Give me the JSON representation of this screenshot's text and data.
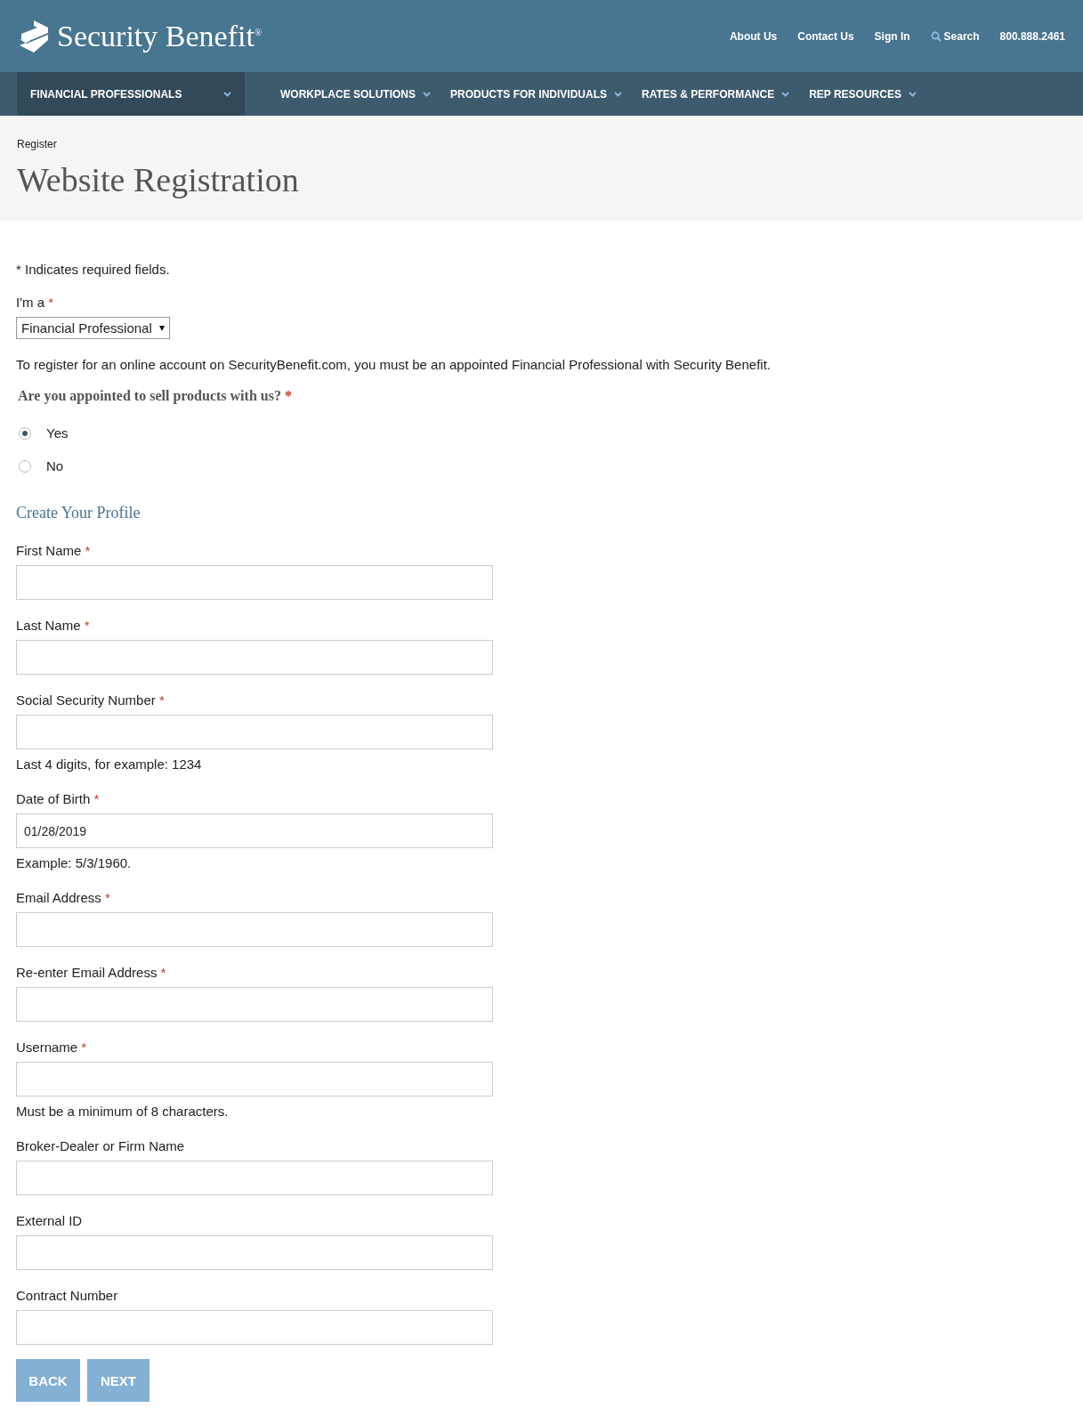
{
  "header": {
    "brand": "Security Benefit",
    "brand_mark": "®",
    "links": [
      "About Us",
      "Contact Us",
      "Sign In"
    ],
    "search": "Search",
    "phone": "800.888.2461"
  },
  "nav": {
    "audience": {
      "label": "FINANCIAL PROFESSIONALS",
      "selected": true
    },
    "items": [
      {
        "label": "WORKPLACE SOLUTIONS"
      },
      {
        "label": "PRODUCTS FOR INDIVIDUALS"
      },
      {
        "label": "RATES & PERFORMANCE"
      },
      {
        "label": "REP RESOURCES"
      }
    ]
  },
  "breadcrumb": "Register",
  "title": "Website Registration",
  "required_note": "* Indicates required fields.",
  "role": {
    "label": "I'm a",
    "required_mark": "*",
    "value": "Financial Professional"
  },
  "intro": "To register for an online account on SecurityBenefit.com, you must be an appointed Financial Professional with Security Benefit.",
  "question": {
    "label": "Are you appointed to sell products with us?",
    "required_mark": "*",
    "options": [
      {
        "label": "Yes",
        "selected": true
      },
      {
        "label": "No",
        "selected": false
      }
    ]
  },
  "section_title": "Create Your Profile",
  "fields": [
    {
      "label": "First Name",
      "required_mark": "*"
    },
    {
      "label": "Last Name",
      "required_mark": "*"
    },
    {
      "label": "Social Security Number",
      "required_mark": "*",
      "hint": "Last 4 digits, for example: 1234"
    },
    {
      "label": "Date of Birth",
      "required_mark": "*",
      "value": "01/28/2019",
      "hint": "Example: 5/3/1960."
    },
    {
      "label": "Email Address",
      "required_mark": "*"
    },
    {
      "label": "Re-enter Email Address",
      "required_mark": "*"
    },
    {
      "label": "Username",
      "required_mark": "*",
      "hint": "Must be a minimum of 8 characters."
    },
    {
      "label": "Broker-Dealer or Firm Name"
    },
    {
      "label": "External ID"
    },
    {
      "label": "Contract Number"
    }
  ],
  "buttons": [
    "BACK",
    "NEXT"
  ]
}
